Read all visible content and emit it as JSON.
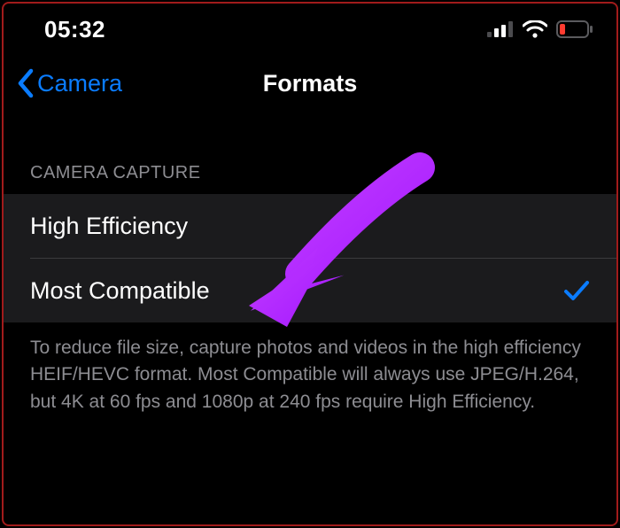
{
  "status": {
    "time": "05:32"
  },
  "nav": {
    "back_label": "Camera",
    "title": "Formats"
  },
  "section": {
    "header": "CAMERA CAPTURE",
    "options": [
      {
        "label": "High Efficiency",
        "selected": false
      },
      {
        "label": "Most Compatible",
        "selected": true
      }
    ],
    "footer": "To reduce file size, capture photos and videos in the high efficiency HEIF/HEVC format. Most Compatible will always use JPEG/H.264, but 4K at 60 fps and 1080p at 240 fps require High Efficiency."
  },
  "colors": {
    "accent": "#0a7cff",
    "annotation": "#b733ff"
  }
}
